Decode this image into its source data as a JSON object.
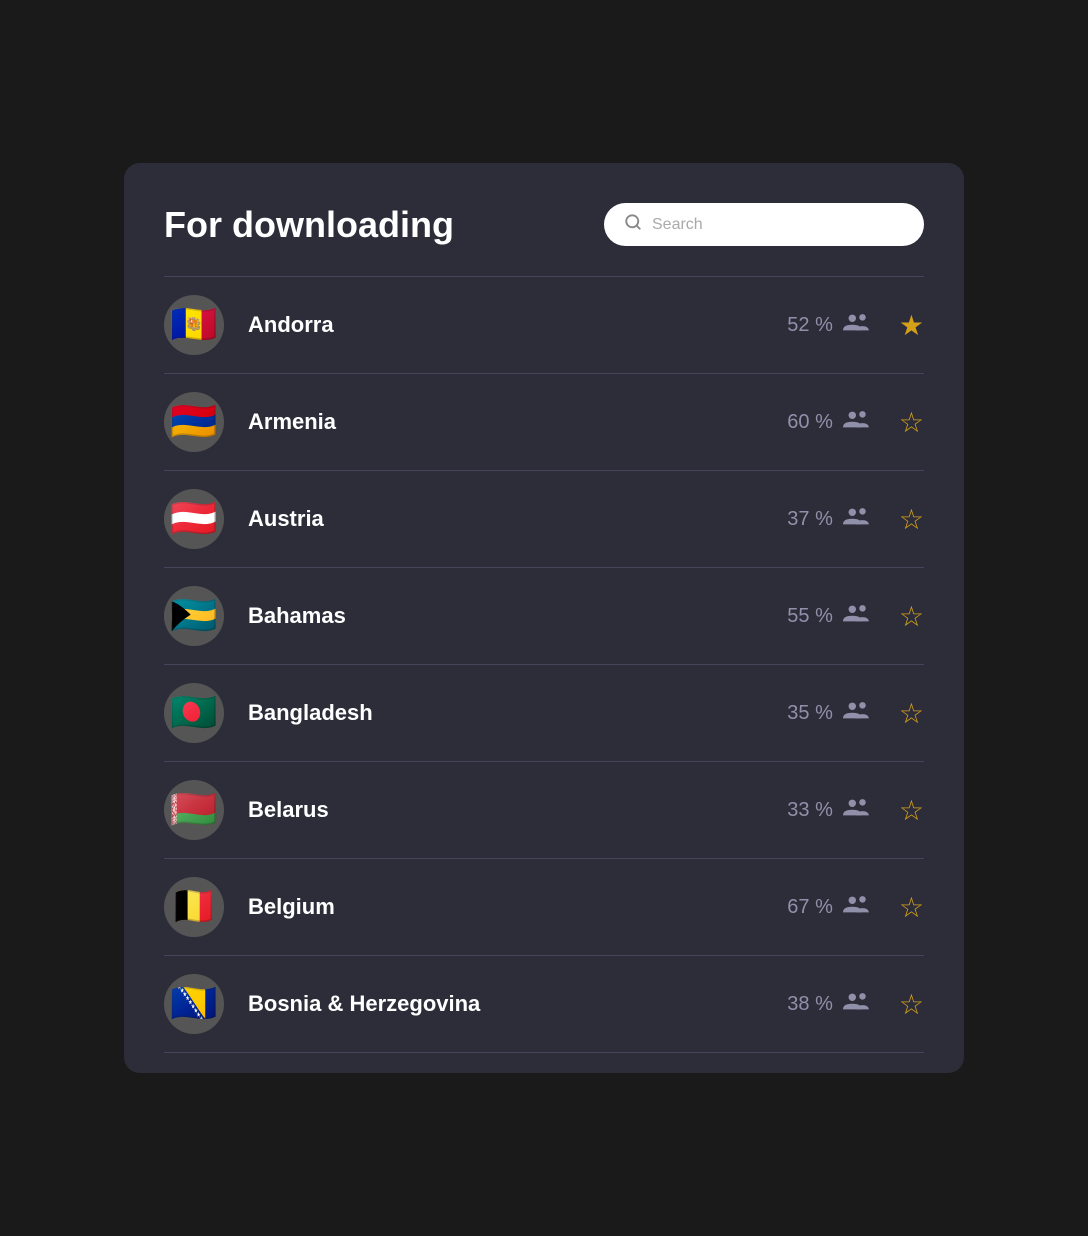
{
  "header": {
    "title": "For downloading",
    "search_placeholder": "Search"
  },
  "countries": [
    {
      "name": "Andorra",
      "percentage": "52 %",
      "flag_emoji": "🇦🇩",
      "starred": true
    },
    {
      "name": "Armenia",
      "percentage": "60 %",
      "flag_emoji": "🇦🇲",
      "starred": false
    },
    {
      "name": "Austria",
      "percentage": "37 %",
      "flag_emoji": "🇦🇹",
      "starred": false
    },
    {
      "name": "Bahamas",
      "percentage": "55 %",
      "flag_emoji": "🇧🇸",
      "starred": false
    },
    {
      "name": "Bangladesh",
      "percentage": "35 %",
      "flag_emoji": "🇧🇩",
      "starred": false
    },
    {
      "name": "Belarus",
      "percentage": "33 %",
      "flag_emoji": "🇧🇾",
      "starred": false
    },
    {
      "name": "Belgium",
      "percentage": "67 %",
      "flag_emoji": "🇧🇪",
      "starred": false
    },
    {
      "name": "Bosnia & Herzegovina",
      "percentage": "38 %",
      "flag_emoji": "🇧🇦",
      "starred": false
    }
  ],
  "icons": {
    "search": "🔍",
    "people": "👥",
    "star_filled": "★",
    "star_empty": "☆"
  }
}
